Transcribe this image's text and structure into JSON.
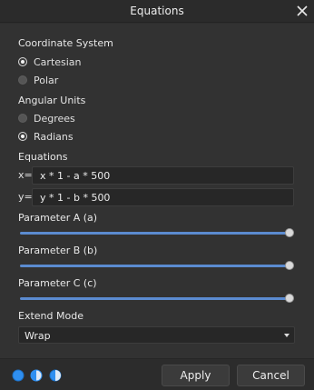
{
  "window": {
    "title": "Equations"
  },
  "coordinate_system": {
    "label": "Coordinate System",
    "options": [
      {
        "label": "Cartesian",
        "selected": true
      },
      {
        "label": "Polar",
        "selected": false
      }
    ]
  },
  "angular_units": {
    "label": "Angular Units",
    "options": [
      {
        "label": "Degrees",
        "selected": false
      },
      {
        "label": "Radians",
        "selected": true
      }
    ]
  },
  "equations": {
    "label": "Equations",
    "x": {
      "prefix": "x=",
      "value": "x * 1 - a * 500"
    },
    "y": {
      "prefix": "y=",
      "value": "y * 1 - b * 500"
    }
  },
  "parameters": [
    {
      "label": "Parameter A (a)",
      "level": 1.0
    },
    {
      "label": "Parameter B (b)",
      "level": 1.0
    },
    {
      "label": "Parameter C (c)",
      "level": 1.0
    }
  ],
  "extend_mode": {
    "label": "Extend Mode",
    "value": "Wrap"
  },
  "footer": {
    "mode_icons": [
      "circle-filled-icon",
      "circle-half-icon",
      "circle-outline-icon"
    ],
    "apply_label": "Apply",
    "cancel_label": "Cancel"
  },
  "colors": {
    "accent": "#5b8bd0",
    "mode_icon_blue": "#2f8ff0"
  }
}
